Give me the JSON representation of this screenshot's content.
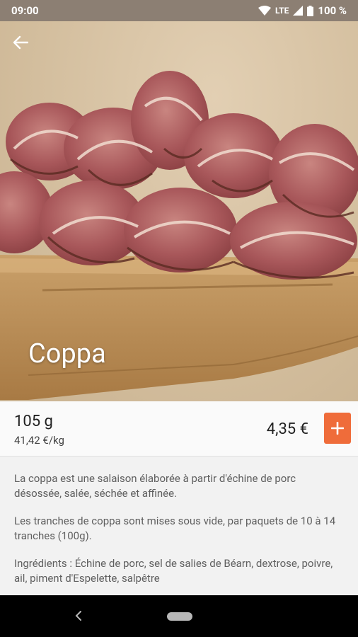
{
  "status_bar": {
    "time": "09:00",
    "network": "LTE",
    "battery": "100 %"
  },
  "product": {
    "name": "Coppa",
    "weight": "105 g",
    "unit_price": "41,42 €/kg",
    "price": "4,35 €"
  },
  "description": {
    "paragraphs": [
      "La coppa est une salaison élaborée à partir d'échine de porc désossée, salée, séchée et affinée.",
      "Les tranches de coppa sont mises sous vide, par paquets de 10 à 14 tranches (100g).",
      "Ingrédients : Échine de porc, sel de salies de Béarn, dextrose, poivre, ail, piment d'Espelette, salpêtre"
    ]
  },
  "icons": {
    "back": "arrow-left-icon",
    "add": "plus-icon",
    "wifi": "wifi-icon",
    "signal": "signal-icon",
    "battery": "battery-icon",
    "nav_back": "chevron-left-icon",
    "nav_home": "home-pill-icon"
  },
  "colors": {
    "accent": "#ef6c3a",
    "status_bar": "#8c7f73",
    "text_primary": "#212121",
    "text_secondary": "#5f5f5f"
  }
}
